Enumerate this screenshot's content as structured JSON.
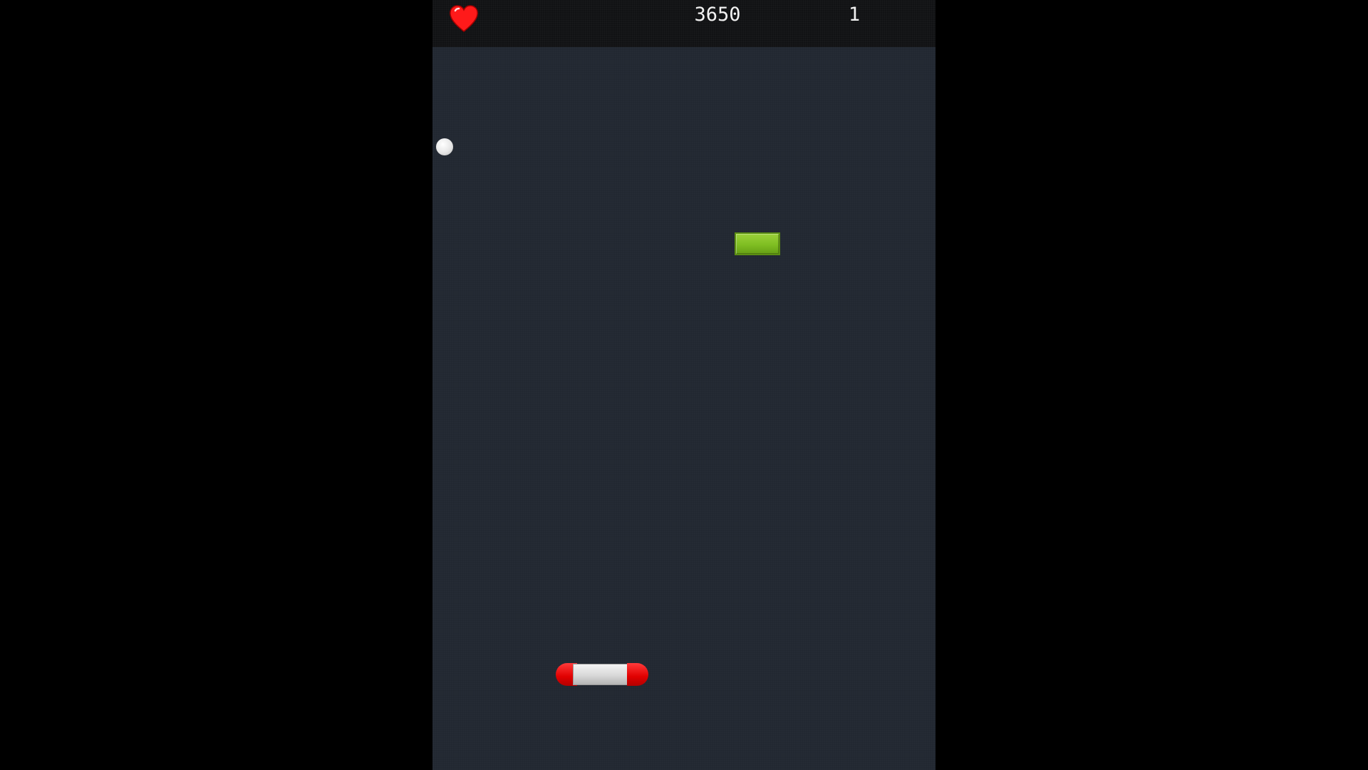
{
  "hud": {
    "lives_icon": "heart-icon",
    "lives_icon_color": "#ff1a1a",
    "score": "3650",
    "level": "1"
  },
  "game": {
    "background_color": "#222831",
    "hud_color": "#111214",
    "ball_color": "#e6e6e6",
    "brick_color": "#7fbe22",
    "paddle_cap_color": "#e00000",
    "paddle_body_color": "#d8d8d8"
  }
}
